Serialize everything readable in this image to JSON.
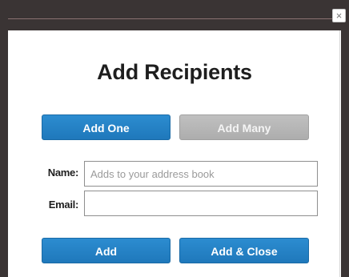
{
  "dialog": {
    "title": "Add Recipients",
    "close_label": "×"
  },
  "mode_tabs": {
    "add_one": "Add One",
    "add_many": "Add Many"
  },
  "form": {
    "name_label": "Name:",
    "name_placeholder": "Adds to your address book",
    "name_value": "",
    "email_label": "Email:",
    "email_value": ""
  },
  "actions": {
    "add": "Add",
    "add_close": "Add & Close"
  },
  "colors": {
    "primary": "#2c8cd0",
    "disabled": "#b5b5b5",
    "backdrop": "#3a3434"
  }
}
